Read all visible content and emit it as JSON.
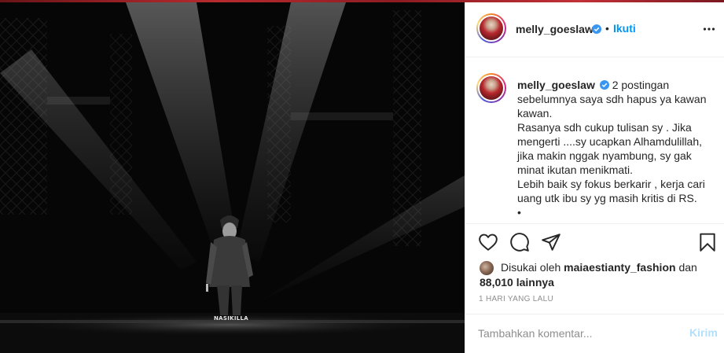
{
  "post": {
    "photo_watermark": "NASIKILLA",
    "username": "melly_goeslaw",
    "separator": "•",
    "follow_label": "Ikuti",
    "caption_lines": [
      "2 postingan",
      "sebelumnya saya sdh hapus ya kawan",
      "kawan.",
      "Rasanya sdh cukup tulisan sy . Jika",
      "mengerti ....sy ucapkan Alhamdulillah,",
      "jika makin nggak nyambung, sy gak",
      "minat ikutan menikmati.",
      "Lebih baik sy fokus berkarir , kerja cari",
      "uang utk ibu sy yg masih kritis di RS.",
      "•"
    ],
    "likes": {
      "prefix": "Disukai oleh",
      "liker": "maiaestianty_fashion",
      "joiner": "dan",
      "count": "88,010 lainnya"
    },
    "timestamp": "1 HARI YANG LALU",
    "comment": {
      "placeholder": "Tambahkan komentar...",
      "post_label": "Kirim"
    },
    "icons": {
      "verified": "verified-badge-icon",
      "more": "more-options-icon",
      "like": "heart-icon",
      "comment": "comment-bubble-icon",
      "share": "paper-plane-icon",
      "save": "bookmark-icon"
    },
    "colors": {
      "link_blue": "#0095f6",
      "verified_blue": "#3897f0",
      "post_disabled": "#b2dffc",
      "muted": "#8e8e8e"
    }
  }
}
